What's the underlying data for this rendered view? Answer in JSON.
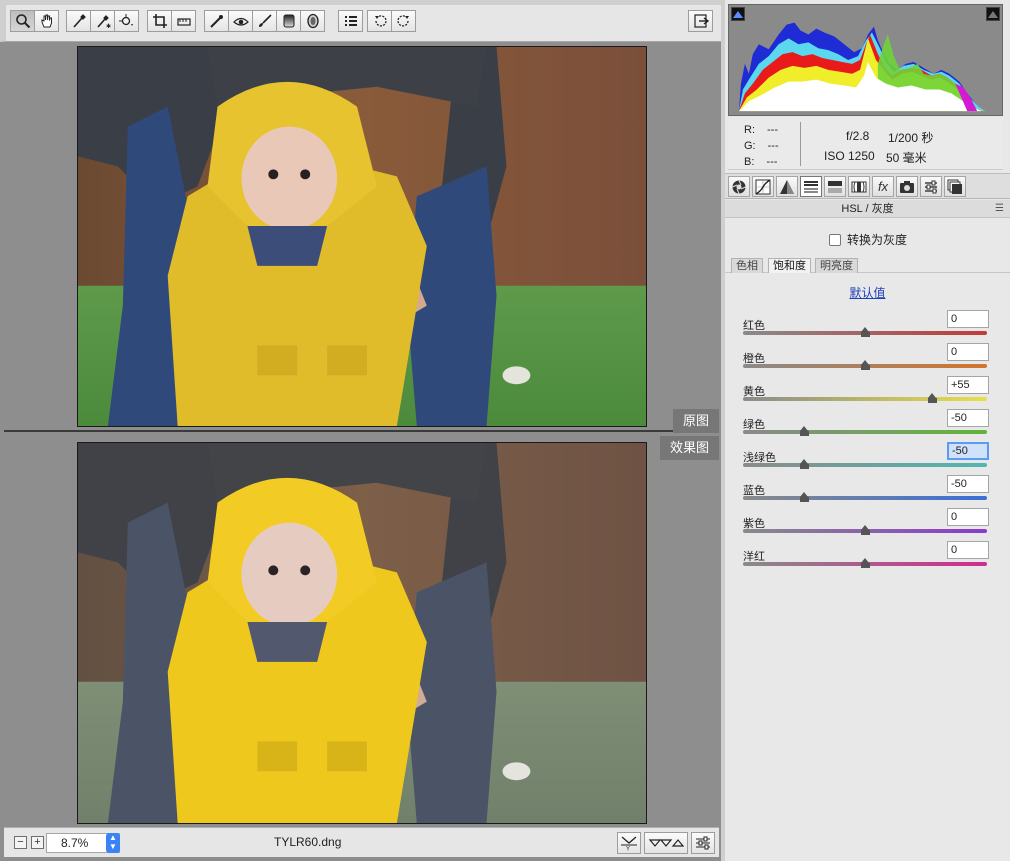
{
  "toolbar": {
    "tools": [
      "zoom-icon",
      "hand-icon",
      "white-balance-icon",
      "color-sampler-icon",
      "target-adjust-icon",
      "crop-icon",
      "straighten-icon",
      "spot-removal-icon",
      "red-eye-icon",
      "adjustment-brush-icon",
      "graduated-filter-icon",
      "radial-filter-icon",
      "list-icon",
      "rotate-left-icon",
      "rotate-right-icon",
      "toggle-fullscreen-icon"
    ]
  },
  "preview": {
    "before_label": "原图",
    "after_label": "效果图"
  },
  "statusbar": {
    "zoom_out": "−",
    "zoom_in": "+",
    "zoom_value": "8.7%",
    "filename": "TYLR60.dng"
  },
  "info": {
    "r_label": "R:",
    "r_value": "---",
    "g_label": "G:",
    "g_value": "---",
    "b_label": "B:",
    "b_value": "---",
    "aperture": "f/2.8",
    "shutter": "1/200 秒",
    "iso": "ISO 1250",
    "focal": "50 毫米"
  },
  "panel": {
    "title": "HSL / 灰度",
    "menu_icon": "☰",
    "convert_gray_label": "转换为灰度",
    "subtabs": [
      "色相",
      "饱和度",
      "明亮度"
    ],
    "active_subtab": 1,
    "defaults_link": "默认值"
  },
  "sliders": [
    {
      "label": "红色",
      "value": "0",
      "numeric": 0,
      "colors": [
        "#8a8a8a",
        "#c23a3a"
      ]
    },
    {
      "label": "橙色",
      "value": "0",
      "numeric": 0,
      "colors": [
        "#8a8a8a",
        "#d3752d"
      ]
    },
    {
      "label": "黄色",
      "value": "+55",
      "numeric": 55,
      "colors": [
        "#8a8a8a",
        "#e8e04a"
      ]
    },
    {
      "label": "绿色",
      "value": "-50",
      "numeric": -50,
      "colors": [
        "#8a8a8a",
        "#5fb53c"
      ]
    },
    {
      "label": "浅绿色",
      "value": "-50",
      "numeric": -50,
      "colors": [
        "#8a8a8a",
        "#4fb8b0"
      ],
      "focus": true
    },
    {
      "label": "蓝色",
      "value": "-50",
      "numeric": -50,
      "colors": [
        "#8a8a8a",
        "#3a6fd6"
      ]
    },
    {
      "label": "紫色",
      "value": "0",
      "numeric": 0,
      "colors": [
        "#8a8a8a",
        "#8a3ad0"
      ]
    },
    {
      "label": "洋红",
      "value": "0",
      "numeric": 0,
      "colors": [
        "#8a8a8a",
        "#d02c8e"
      ]
    }
  ],
  "colors": {
    "accent": "#3b82f6",
    "link": "#1d3fb8"
  }
}
